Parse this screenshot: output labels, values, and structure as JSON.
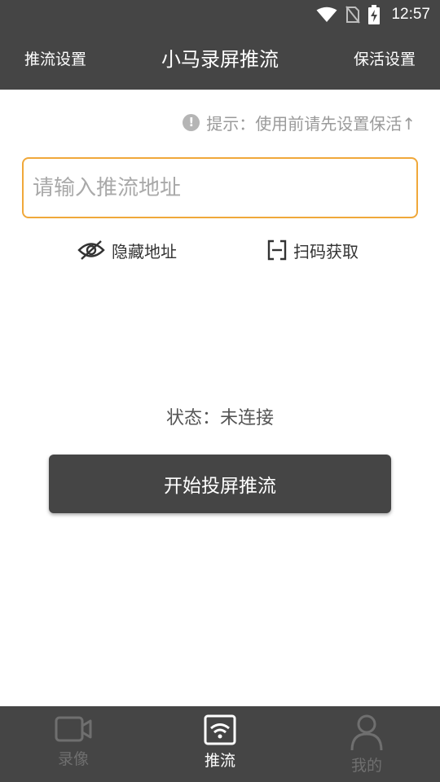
{
  "status_bar": {
    "time": "12:57",
    "icons": [
      "wifi-icon",
      "no-sim-icon",
      "battery-charging-icon"
    ]
  },
  "app_bar": {
    "left_action": "推流设置",
    "title": "小马录屏推流",
    "right_action": "保活设置"
  },
  "hint": {
    "icon": "info-icon",
    "text": "提示：使用前请先设置保活↑"
  },
  "stream_input": {
    "value": "",
    "placeholder": "请输入推流地址"
  },
  "actions": {
    "hide_address": {
      "icon": "eye-off-icon",
      "label": "隐藏地址"
    },
    "scan_code": {
      "icon": "scan-icon",
      "label": "扫码获取"
    }
  },
  "connection": {
    "status_text": "状态：未连接"
  },
  "start_button": {
    "label": "开始投屏推流"
  },
  "bottom_nav": {
    "items": [
      {
        "label": "录像",
        "icon": "video-camera-icon",
        "active": false
      },
      {
        "label": "推流",
        "icon": "wifi-stream-icon",
        "active": true
      },
      {
        "label": "我的",
        "icon": "user-icon",
        "active": false
      }
    ]
  },
  "colors": {
    "bar_background": "#454545",
    "accent_border": "#f0a83a",
    "inactive_nav": "#6f6f6f"
  }
}
